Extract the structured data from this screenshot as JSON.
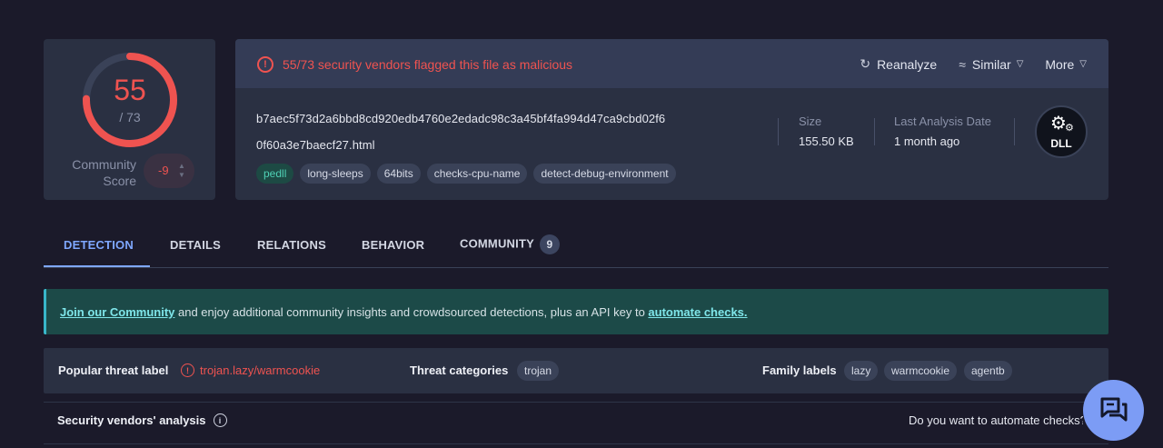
{
  "score": {
    "detections": "55",
    "total": "/ 73",
    "detection_fraction": 0.7534,
    "community_label_line1": "Community",
    "community_label_line2": "Score",
    "community_value": "-9"
  },
  "header": {
    "alert_text": "55/73 security vendors flagged this file as malicious",
    "reanalyze_label": "Reanalyze",
    "similar_label": "Similar",
    "more_label": "More"
  },
  "file": {
    "hash_line1": "b7aec5f73d2a6bbd8cd920edb4760e2edadc98c3a45bf4fa994d47ca9cbd02f6",
    "hash_line2": "0f60a3e7baecf27.html",
    "tags": [
      "pedll",
      "long-sleeps",
      "64bits",
      "checks-cpu-name",
      "detect-debug-environment"
    ],
    "size_label": "Size",
    "size_value": "155.50 KB",
    "last_analysis_label": "Last Analysis Date",
    "last_analysis_value": "1 month ago",
    "type_badge": "DLL"
  },
  "tabs": [
    {
      "label": "DETECTION",
      "active": true
    },
    {
      "label": "DETAILS"
    },
    {
      "label": "RELATIONS"
    },
    {
      "label": "BEHAVIOR"
    },
    {
      "label": "COMMUNITY",
      "badge": "9"
    }
  ],
  "banner": {
    "link1": "Join our Community",
    "middle": " and enjoy additional community insights and crowdsourced detections, plus an API key to ",
    "link2": "automate checks."
  },
  "threat": {
    "popular_label": "Popular threat label",
    "popular_value": "trojan.lazy/warmcookie",
    "categories_label": "Threat categories",
    "categories": [
      "trojan"
    ],
    "family_label": "Family labels",
    "families": [
      "lazy",
      "warmcookie",
      "agentb"
    ]
  },
  "vendors": {
    "title": "Security vendors' analysis",
    "automate_prompt": "Do you want to automate checks?"
  },
  "colors": {
    "background": "#1b1a2a",
    "card": "#2a3042",
    "malicious_red": "#ef5350",
    "accent_blue": "#7fa8ff",
    "banner_teal": "#1c4a48"
  }
}
